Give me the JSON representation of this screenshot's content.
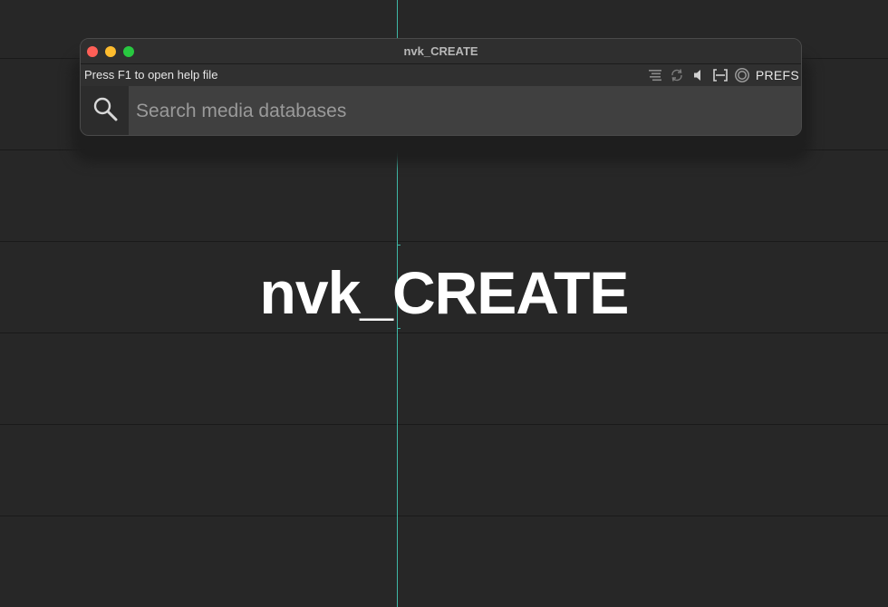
{
  "window": {
    "title": "nvk_CREATE"
  },
  "toolbar": {
    "help_text": "Press F1 to open help file",
    "icons": [
      "align-icon",
      "refresh-icon",
      "speaker-icon",
      "bracket-icon",
      "circle-icon"
    ],
    "prefs_label": "PREFS"
  },
  "search": {
    "placeholder": "Search media databases",
    "value": ""
  },
  "canvas": {
    "title": "nvk_CREATE"
  },
  "colors": {
    "cursor": "#3fb8a6",
    "close": "#fe5f57",
    "minimize": "#febc2e",
    "maximize": "#28c840"
  }
}
